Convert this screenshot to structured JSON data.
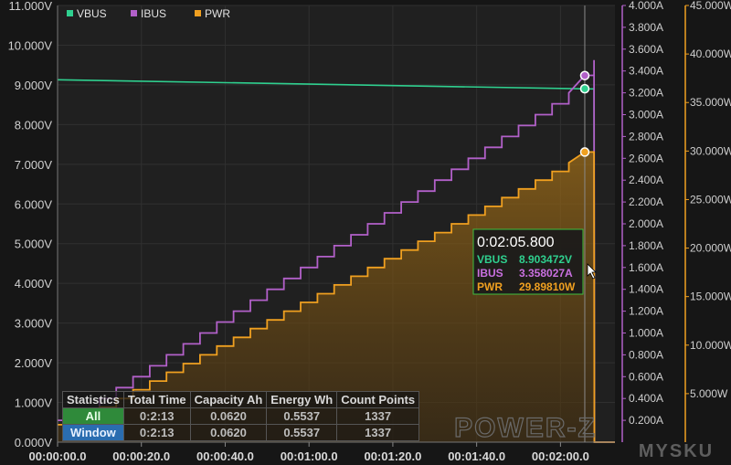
{
  "chart_data": {
    "type": "line",
    "x_axis": {
      "tick_labels": [
        "00:00:00.0",
        "00:00:20.0",
        "00:00:40.0",
        "00:01:00.0",
        "00:01:20.0",
        "00:01:40.0",
        "00:02:00.0"
      ],
      "tick_seconds": [
        0,
        20,
        40,
        60,
        80,
        100,
        120
      ],
      "range_seconds": [
        0,
        133
      ]
    },
    "y_axes": {
      "voltage": {
        "range": [
          0,
          11
        ],
        "tick_labels": [
          "0.000V",
          "1.000V",
          "2.000V",
          "3.000V",
          "4.000V",
          "5.000V",
          "6.000V",
          "7.000V",
          "8.000V",
          "9.000V",
          "10.000V",
          "11.000V"
        ]
      },
      "current": {
        "range": [
          0,
          4
        ],
        "tick_labels": [
          "0.200A",
          "0.400A",
          "0.600A",
          "0.800A",
          "1.000A",
          "1.200A",
          "1.400A",
          "1.600A",
          "1.800A",
          "2.000A",
          "2.200A",
          "2.400A",
          "2.600A",
          "2.800A",
          "3.000A",
          "3.200A",
          "3.400A",
          "3.600A",
          "3.800A",
          "4.000A"
        ]
      },
      "power": {
        "range": [
          0,
          45
        ],
        "tick_labels": [
          "5.000W",
          "10.000W",
          "15.000W",
          "20.000W",
          "25.000W",
          "30.000W",
          "35.000W",
          "40.000W",
          "45.000W"
        ]
      }
    },
    "series": [
      {
        "name": "VBUS",
        "color": "#2fd08f",
        "axis": "voltage",
        "x": [
          0,
          125.8,
          128,
          128.1,
          133
        ],
        "y": [
          9.13,
          8.9,
          8.9,
          0.0,
          0.0
        ]
      },
      {
        "name": "IBUS",
        "color": "#b260c9",
        "axis": "current",
        "x": [
          0,
          6,
          6,
          10,
          10,
          14,
          14,
          18,
          18,
          22,
          22,
          26,
          26,
          30,
          30,
          34,
          34,
          38,
          38,
          42,
          42,
          46,
          46,
          50,
          50,
          54,
          54,
          58,
          58,
          62,
          62,
          66,
          66,
          70,
          70,
          74,
          74,
          78,
          78,
          82,
          82,
          86,
          86,
          90,
          90,
          94,
          94,
          98,
          98,
          102,
          102,
          106,
          106,
          110,
          110,
          114,
          114,
          118,
          118,
          122,
          122,
          125.8,
          128,
          128,
          128.1,
          133
        ],
        "y": [
          0.2,
          0.2,
          0.3,
          0.3,
          0.4,
          0.4,
          0.5,
          0.5,
          0.6,
          0.6,
          0.7,
          0.7,
          0.8,
          0.8,
          0.9,
          0.9,
          1.0,
          1.0,
          1.1,
          1.1,
          1.2,
          1.2,
          1.3,
          1.3,
          1.4,
          1.4,
          1.5,
          1.5,
          1.6,
          1.6,
          1.7,
          1.7,
          1.8,
          1.8,
          1.9,
          1.9,
          2.0,
          2.0,
          2.1,
          2.1,
          2.2,
          2.2,
          2.3,
          2.3,
          2.4,
          2.4,
          2.5,
          2.5,
          2.6,
          2.6,
          2.7,
          2.7,
          2.8,
          2.8,
          2.9,
          2.9,
          3.0,
          3.0,
          3.1,
          3.1,
          3.2,
          3.36,
          3.36,
          3.5,
          0.0,
          0.0
        ]
      },
      {
        "name": "PWR",
        "color": "#f0a020",
        "axis": "power",
        "x": [
          0,
          6,
          6,
          10,
          10,
          14,
          14,
          18,
          18,
          22,
          22,
          26,
          26,
          30,
          30,
          34,
          34,
          38,
          38,
          42,
          42,
          46,
          46,
          50,
          50,
          54,
          54,
          58,
          58,
          62,
          62,
          66,
          66,
          70,
          70,
          74,
          74,
          78,
          78,
          82,
          82,
          86,
          86,
          90,
          90,
          94,
          94,
          98,
          98,
          102,
          102,
          106,
          106,
          110,
          110,
          114,
          114,
          118,
          118,
          122,
          122,
          125.8,
          128,
          128.1,
          133
        ],
        "y": [
          1.8,
          1.8,
          2.7,
          2.7,
          3.6,
          3.6,
          4.5,
          4.5,
          5.4,
          5.4,
          6.3,
          6.3,
          7.2,
          7.2,
          8.1,
          8.1,
          9.0,
          9.0,
          9.9,
          9.9,
          10.8,
          10.8,
          11.7,
          11.7,
          12.6,
          12.6,
          13.5,
          13.5,
          14.4,
          14.4,
          15.3,
          15.3,
          16.2,
          16.2,
          17.1,
          17.1,
          18.0,
          18.0,
          18.9,
          18.9,
          19.8,
          19.8,
          20.7,
          20.7,
          21.6,
          21.6,
          22.5,
          22.5,
          23.4,
          23.4,
          24.3,
          24.3,
          25.2,
          25.2,
          26.1,
          26.1,
          27.0,
          27.0,
          27.9,
          27.9,
          28.8,
          29.9,
          29.9,
          0.0,
          0.0
        ]
      }
    ],
    "legend": {
      "placement": "top-left",
      "entries": [
        "VBUS",
        "IBUS",
        "PWR"
      ]
    },
    "cursor": {
      "x": 125.8
    },
    "tooltip": {
      "time": "0:02:05.800",
      "rows": [
        {
          "label": "VBUS",
          "value": "8.903472V",
          "color": "#2fd08f"
        },
        {
          "label": "IBUS",
          "value": "3.358027A",
          "color": "#c970e0"
        },
        {
          "label": "PWR",
          "value": "29.89810W",
          "color": "#f0a020"
        }
      ]
    },
    "markers": [
      {
        "series": "VBUS",
        "x": 125.8,
        "y": 8.903472
      },
      {
        "series": "IBUS",
        "x": 125.8,
        "y": 3.358027
      },
      {
        "series": "PWR",
        "x": 125.8,
        "y": 29.8981
      }
    ],
    "grid": true
  },
  "statistics": {
    "headers": [
      "Statistics",
      "Total Time",
      "Capacity Ah",
      "Energy Wh",
      "Count Points"
    ],
    "rows": [
      {
        "label": "All",
        "total_time": "0:2:13",
        "capacity": "0.0620",
        "energy": "0.5537",
        "count": "1337"
      },
      {
        "label": "Window",
        "total_time": "0:2:13",
        "capacity": "0.0620",
        "energy": "0.5537",
        "count": "1337"
      }
    ]
  },
  "watermark": {
    "brand": "POWER-Z",
    "site": "MYSKU"
  },
  "colors": {
    "background": "#161616",
    "plot_bg": "#202020",
    "grid": "#303030",
    "voltage_axis": "#cfcfcf",
    "current_axis": "#b260c9",
    "power_axis": "#f0a020"
  }
}
